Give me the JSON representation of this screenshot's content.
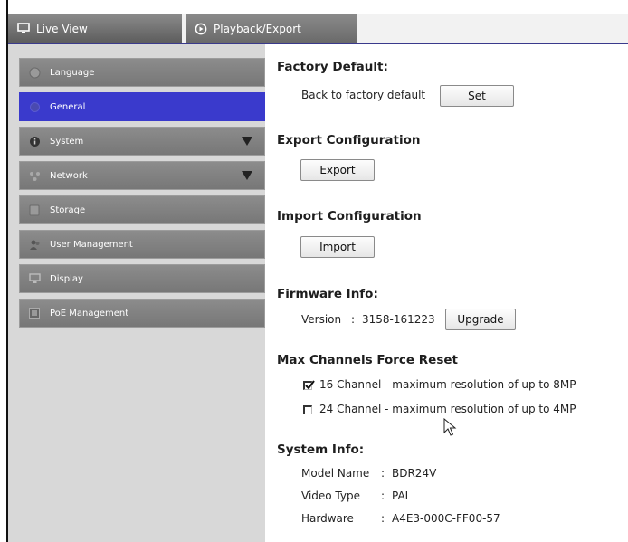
{
  "tabs": [
    {
      "label": "Live View",
      "icon": "monitor-icon"
    },
    {
      "label": "Playback/Export",
      "icon": "play-circle-icon"
    }
  ],
  "sidebar": {
    "items": [
      {
        "label": "Language",
        "icon": "globe-icon",
        "active": false,
        "expandable": false
      },
      {
        "label": "General",
        "icon": "gear-icon",
        "active": true,
        "expandable": false
      },
      {
        "label": "System",
        "icon": "info-icon",
        "active": false,
        "expandable": true
      },
      {
        "label": "Network",
        "icon": "network-icon",
        "active": false,
        "expandable": true
      },
      {
        "label": "Storage",
        "icon": "storage-icon",
        "active": false,
        "expandable": false
      },
      {
        "label": "User Management",
        "icon": "users-icon",
        "active": false,
        "expandable": false
      },
      {
        "label": "Display",
        "icon": "display-icon",
        "active": false,
        "expandable": false
      },
      {
        "label": "PoE Management",
        "icon": "poe-icon",
        "active": false,
        "expandable": false
      }
    ]
  },
  "main": {
    "factory": {
      "heading": "Factory Default:",
      "label": "Back to factory default",
      "button": "Set"
    },
    "export": {
      "heading": "Export Configuration",
      "button": "Export"
    },
    "import": {
      "heading": "Import Configuration",
      "button": "Import"
    },
    "firmware": {
      "heading": "Firmware Info:",
      "version_label": "Version",
      "separator": ":",
      "version": "3158-161223",
      "button": "Upgrade"
    },
    "channels": {
      "heading": "Max Channels Force Reset",
      "options": [
        {
          "label": "16 Channel - maximum resolution of up to 8MP",
          "checked": true
        },
        {
          "label": "24 Channel - maximum resolution of up to 4MP",
          "checked": false
        }
      ]
    },
    "system_info": {
      "heading": "System Info:",
      "rows": [
        {
          "label": "Model Name",
          "sep": ":",
          "value": "BDR24V"
        },
        {
          "label": "Video Type",
          "sep": ":",
          "value": "PAL"
        },
        {
          "label": "Hardware",
          "sep": ":",
          "value": "A4E3-000C-FF00-57"
        }
      ]
    }
  },
  "colors": {
    "active_item": "#3a3acc",
    "accent_line": "#3a3a8c",
    "sidebar_bg": "#d8d8d8",
    "item_bg": "#808080"
  }
}
